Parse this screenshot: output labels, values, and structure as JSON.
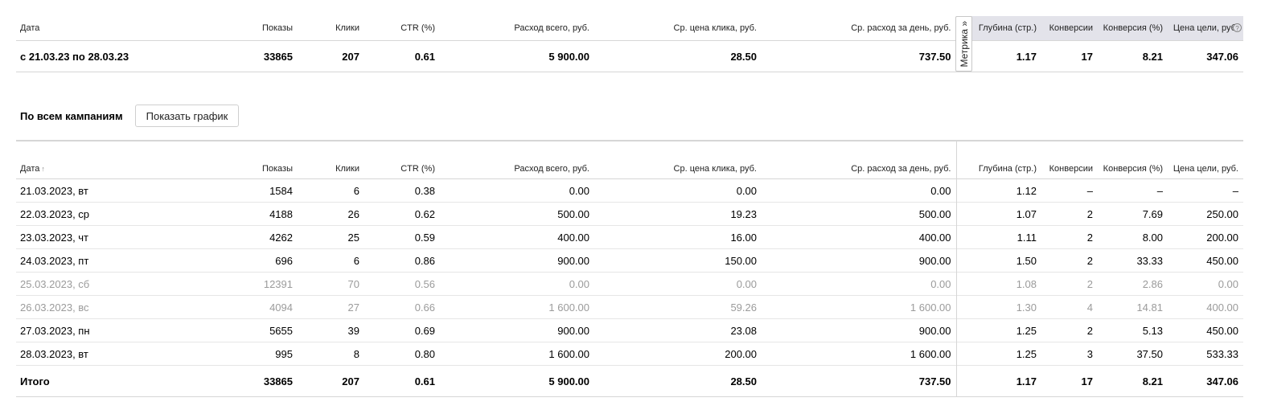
{
  "columns": [
    "Дата",
    "Показы",
    "Клики",
    "CTR (%)",
    "Расход всего, руб.",
    "Ср. цена клика, руб.",
    "Ср. расход за день, руб.",
    "Глубина (стр.)",
    "Конверсии",
    "Конверсия (%)",
    "Цена цели, руб."
  ],
  "summary": {
    "row": [
      "с 21.03.23 по 28.03.23",
      "33865",
      "207",
      "0.61",
      "5 900.00",
      "28.50",
      "737.50",
      "1.17",
      "17",
      "8.21",
      "347.06"
    ],
    "metrika_label": "Метрика »"
  },
  "controls": {
    "section_label": "По всем кампаниям",
    "chart_button": "Показать график"
  },
  "detail": {
    "sort_icon": "↑",
    "rows": [
      {
        "muted": false,
        "cells": [
          "21.03.2023, вт",
          "1584",
          "6",
          "0.38",
          "0.00",
          "0.00",
          "0.00",
          "1.12",
          "–",
          "–",
          "–"
        ]
      },
      {
        "muted": false,
        "cells": [
          "22.03.2023, ср",
          "4188",
          "26",
          "0.62",
          "500.00",
          "19.23",
          "500.00",
          "1.07",
          "2",
          "7.69",
          "250.00"
        ]
      },
      {
        "muted": false,
        "cells": [
          "23.03.2023, чт",
          "4262",
          "25",
          "0.59",
          "400.00",
          "16.00",
          "400.00",
          "1.11",
          "2",
          "8.00",
          "200.00"
        ]
      },
      {
        "muted": false,
        "cells": [
          "24.03.2023, пт",
          "696",
          "6",
          "0.86",
          "900.00",
          "150.00",
          "900.00",
          "1.50",
          "2",
          "33.33",
          "450.00"
        ]
      },
      {
        "muted": true,
        "cells": [
          "25.03.2023, сб",
          "12391",
          "70",
          "0.56",
          "0.00",
          "0.00",
          "0.00",
          "1.08",
          "2",
          "2.86",
          "0.00"
        ]
      },
      {
        "muted": true,
        "cells": [
          "26.03.2023, вс",
          "4094",
          "27",
          "0.66",
          "1 600.00",
          "59.26",
          "1 600.00",
          "1.30",
          "4",
          "14.81",
          "400.00"
        ]
      },
      {
        "muted": false,
        "cells": [
          "27.03.2023, пн",
          "5655",
          "39",
          "0.69",
          "900.00",
          "23.08",
          "900.00",
          "1.25",
          "2",
          "5.13",
          "450.00"
        ]
      },
      {
        "muted": false,
        "cells": [
          "28.03.2023, вт",
          "995",
          "8",
          "0.80",
          "1 600.00",
          "200.00",
          "1 600.00",
          "1.25",
          "3",
          "37.50",
          "533.33"
        ]
      }
    ],
    "total": [
      "Итого",
      "33865",
      "207",
      "0.61",
      "5 900.00",
      "28.50",
      "737.50",
      "1.17",
      "17",
      "8.21",
      "347.06"
    ]
  }
}
